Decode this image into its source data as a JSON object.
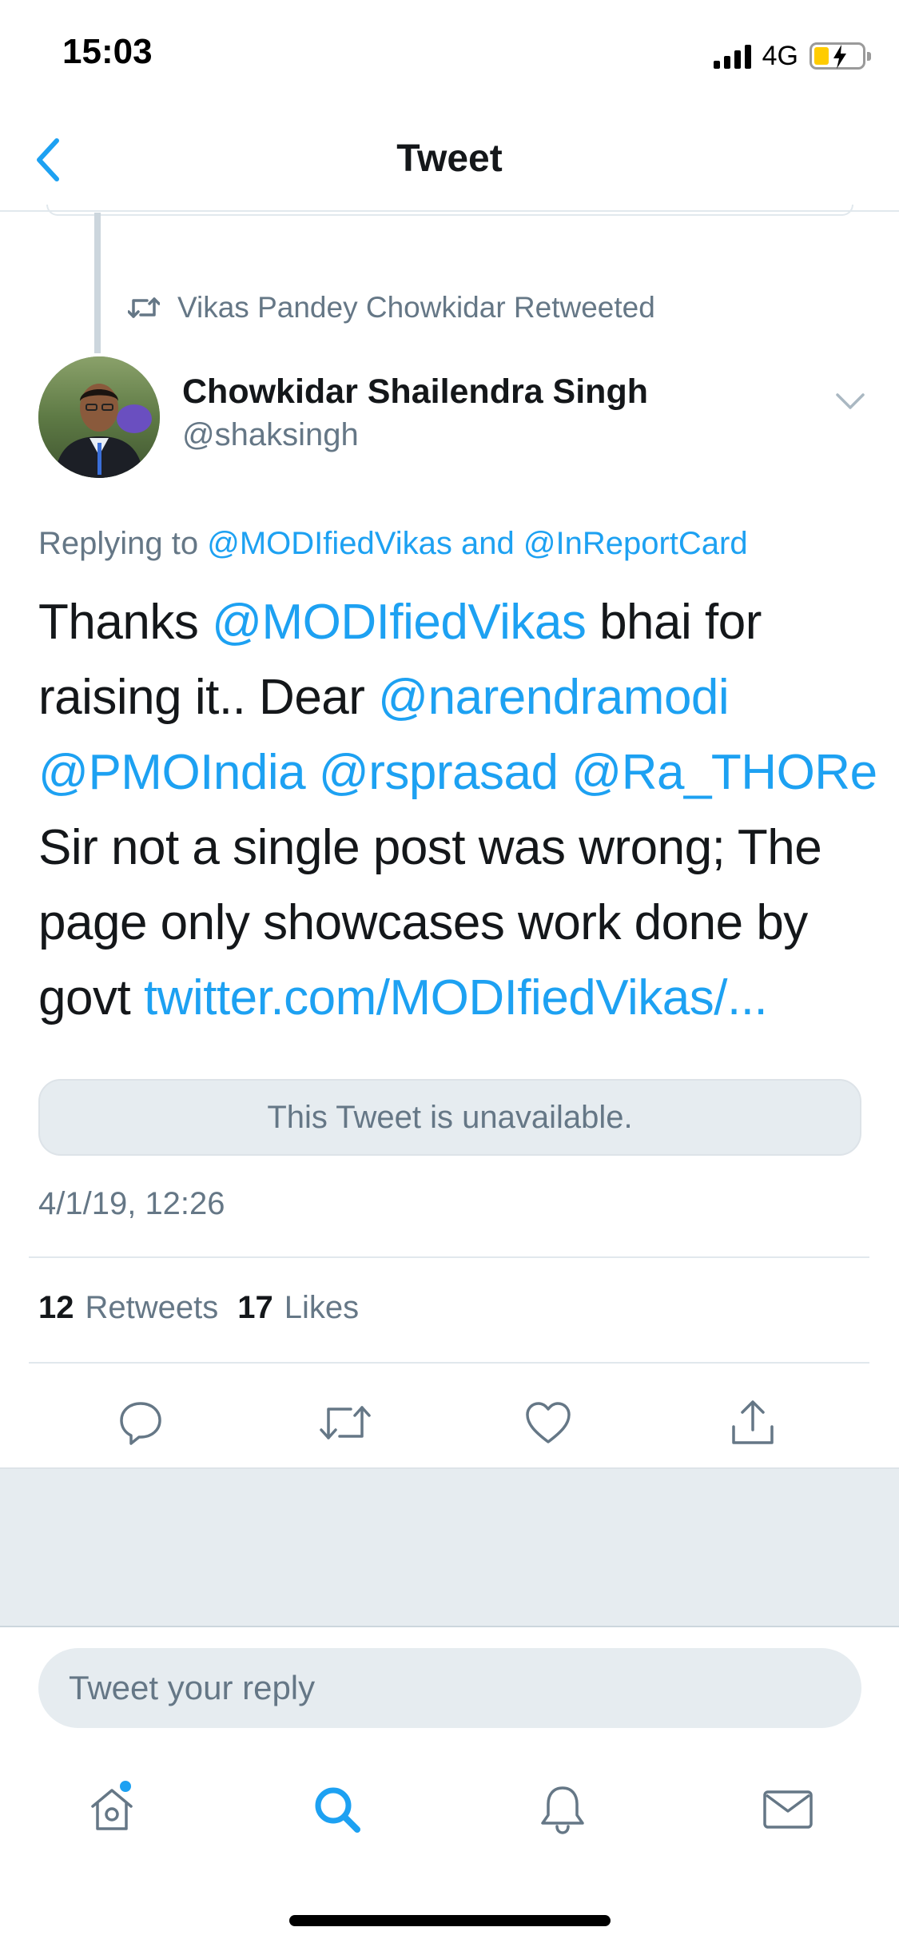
{
  "status_bar": {
    "time": "15:03",
    "network": "4G"
  },
  "header": {
    "title": "Tweet"
  },
  "retweet_context": {
    "text": "Vikas Pandey Chowkidar Retweeted"
  },
  "author": {
    "name": "Chowkidar Shailendra Singh",
    "handle": "@shaksingh"
  },
  "replying_to": {
    "prefix": "Replying to",
    "user1": "@MODIfiedVikas",
    "conjunction": "and",
    "user2": "@InReportCard"
  },
  "tweet": {
    "t1": "Thanks",
    "m1": "@MODIfiedVikas",
    "t2": "bhai for",
    "t3": "raising it.. Dear",
    "m2": "@narendramodi",
    "m3": "@PMOIndia",
    "m4": "@rsprasad",
    "m5": "@Ra_THORe",
    "t4": "Sir not a single post was wrong; The",
    "t5": "page only showcases work done by",
    "t6": "govt",
    "url": "twitter.com/MODIfiedVikas/..."
  },
  "quoted": {
    "unavailable_text": "This Tweet is unavailable."
  },
  "timestamp": "4/1/19, 12:26",
  "stats": {
    "retweets_count": "12",
    "retweets_label": "Retweets",
    "likes_count": "17",
    "likes_label": "Likes"
  },
  "reply": {
    "placeholder": "Tweet your reply"
  },
  "colors": {
    "link": "#1da1f2",
    "secondary_text": "#657786",
    "primary_text": "#14171a",
    "background_gray": "#e6ecf0"
  },
  "icons": {
    "back": "chevron-left-icon",
    "retweet_context": "retweet-icon",
    "caret": "chevron-down-icon",
    "reply": "reply-icon",
    "retweet": "retweet-icon",
    "like": "heart-icon",
    "share": "share-icon",
    "home": "home-icon",
    "search": "search-icon",
    "notifications": "bell-icon",
    "messages": "mail-icon"
  }
}
